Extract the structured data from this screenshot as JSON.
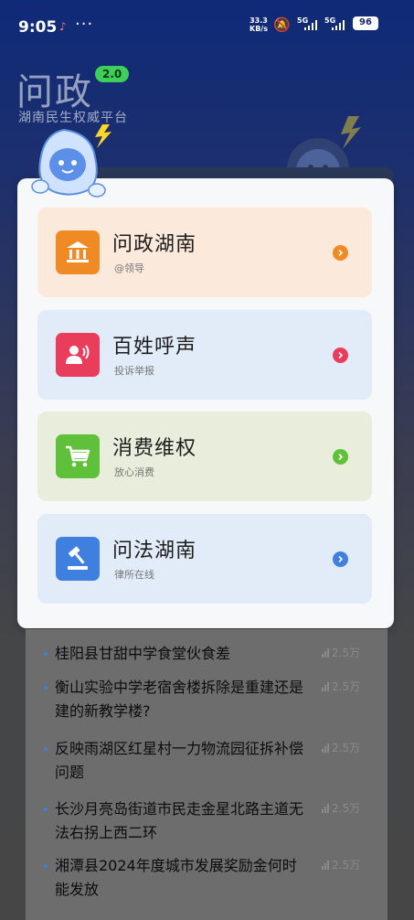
{
  "status_bar": {
    "time": "9:05",
    "dots": "···",
    "net_speed_value": "33.3",
    "net_speed_unit": "KB/s",
    "sig1": "5G",
    "sig2": "5G",
    "battery": "96"
  },
  "brand": {
    "title": "问政",
    "version": "2.0",
    "subtitle": "湖南民生权威平台"
  },
  "menu_cards": [
    {
      "title": "问政湖南",
      "subtitle": "@领导",
      "icon": "bank-icon",
      "bg": "#fbeadb",
      "icon_bg": "#f08a24",
      "arrow": "#f08a24"
    },
    {
      "title": "百姓呼声",
      "subtitle": "投诉举报",
      "icon": "speaker-person-icon",
      "bg": "#e1ecf8",
      "icon_bg": "#ea3d5c",
      "arrow": "#ea3d5c"
    },
    {
      "title": "消费维权",
      "subtitle": "放心消费",
      "icon": "cart-icon",
      "bg": "#e8eedb",
      "icon_bg": "#5fc13a",
      "arrow": "#5fc13a"
    },
    {
      "title": "问法湖南",
      "subtitle": "律所在线",
      "icon": "gavel-icon",
      "bg": "#e1ecf8",
      "icon_bg": "#3f7fe0",
      "arrow": "#3f7fe0"
    }
  ],
  "news": [
    {
      "text": "桂阳县甘甜中学食堂伙食差",
      "views": "2.5万"
    },
    {
      "text": "衡山实验中学老宿舍楼拆除是重建还是建的新教学楼?",
      "views": "2.5万"
    },
    {
      "text": "反映雨湖区红星村一力物流园征拆补偿问题",
      "views": "2.5万"
    },
    {
      "text": "长沙月亮岛街道市民走金星北路主道无法右拐上西二环",
      "views": "2.5万"
    },
    {
      "text": "湘潭县2024年度城市发展奖励金何时能发放",
      "views": "2.5万"
    }
  ]
}
